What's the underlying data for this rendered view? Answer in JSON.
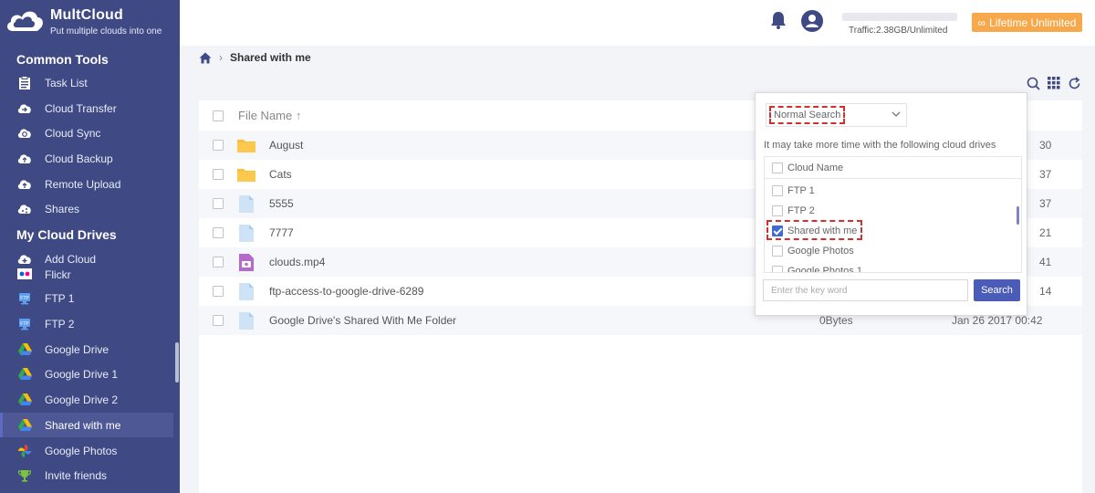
{
  "brand": {
    "name": "MultCloud",
    "tagline": "Put multiple clouds into one"
  },
  "sidebar": {
    "common_tools_title": "Common Tools",
    "common_tools": [
      {
        "label": "Task List",
        "icon": "task-list-icon"
      },
      {
        "label": "Cloud Transfer",
        "icon": "cloud-transfer-icon"
      },
      {
        "label": "Cloud Sync",
        "icon": "cloud-sync-icon"
      },
      {
        "label": "Cloud Backup",
        "icon": "cloud-backup-icon"
      },
      {
        "label": "Remote Upload",
        "icon": "remote-upload-icon"
      },
      {
        "label": "Shares",
        "icon": "shares-icon"
      }
    ],
    "my_drives_title": "My Cloud Drives",
    "drives": [
      {
        "label": "Add Cloud",
        "icon": "add-cloud-icon"
      },
      {
        "label": "Flickr",
        "icon": "flickr-icon"
      },
      {
        "label": "FTP 1",
        "icon": "ftp-icon"
      },
      {
        "label": "FTP 2",
        "icon": "ftp-icon"
      },
      {
        "label": "Google Drive",
        "icon": "google-drive-icon"
      },
      {
        "label": "Google Drive 1",
        "icon": "google-drive-icon"
      },
      {
        "label": "Google Drive 2",
        "icon": "google-drive-icon"
      },
      {
        "label": "Shared with me",
        "icon": "google-drive-icon",
        "active": true
      },
      {
        "label": "Google Photos",
        "icon": "google-photos-icon"
      },
      {
        "label": "Invite friends",
        "icon": "trophy-icon"
      }
    ]
  },
  "header": {
    "traffic": "Traffic:2.38GB/Unlimited",
    "lifetime_label": "Lifetime Unlimited"
  },
  "breadcrumb": {
    "current": "Shared with me"
  },
  "filelist": {
    "header_name": "File Name",
    "rows": [
      {
        "name": "August",
        "type": "folder",
        "size": "",
        "date": "30"
      },
      {
        "name": "Cats",
        "type": "folder",
        "size": "",
        "date": "37"
      },
      {
        "name": "5555",
        "type": "file",
        "size": "",
        "date": "37"
      },
      {
        "name": "7777",
        "type": "file",
        "size": "",
        "date": "21"
      },
      {
        "name": "clouds.mp4",
        "type": "video",
        "size": "",
        "date": "41"
      },
      {
        "name": "ftp-access-to-google-drive-6289",
        "type": "file",
        "size": "",
        "date": "14"
      },
      {
        "name": "Google Drive's Shared With Me Folder",
        "type": "file",
        "size": "0Bytes",
        "date": "Jan 26 2017 00:42"
      }
    ]
  },
  "search_popup": {
    "mode": "Normal Search",
    "hint": "It may take more time with the following cloud drives",
    "list_header": "Cloud Name",
    "clouds": [
      {
        "label": "FTP 1",
        "checked": false
      },
      {
        "label": "FTP 2",
        "checked": false
      },
      {
        "label": "Shared with me",
        "checked": true
      },
      {
        "label": "Google Photos",
        "checked": false
      },
      {
        "label": "Google Photos 1",
        "checked": false
      }
    ],
    "keyword_placeholder": "Enter the key word",
    "search_button": "Search"
  },
  "colors": {
    "sidebar_bg": "#3f4a85",
    "accent": "#4a5cb8",
    "lifetime_bg": "#f6a84a",
    "highlight_red": "#d32f2f"
  }
}
